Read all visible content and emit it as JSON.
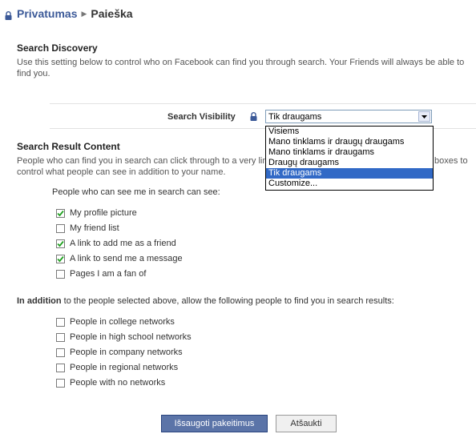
{
  "breadcrumb": {
    "parent": "Privatumas",
    "current": "Paieška"
  },
  "discovery": {
    "title": "Search Discovery",
    "description": "Use this setting below to control who on Facebook can find you through search. Your Friends will always be able to find you."
  },
  "visibility": {
    "label": "Search Visibility",
    "selected": "Tik draugams",
    "options": [
      "Visiems",
      "Mano tinklams ir draugų draugams",
      "Mano tinklams ir draugams",
      "Draugų draugams",
      "Tik draugams",
      "Customize..."
    ],
    "highlighted_index": 4
  },
  "result_content": {
    "title": "Search Result Content",
    "description_left": "People who can find you in search can click through to a very limi",
    "description_right": "boxes to",
    "description_line2": "control what people can see in addition to your name.",
    "subheading": "People who can see me in search can see:",
    "options": [
      {
        "label": "My profile picture",
        "checked": true
      },
      {
        "label": "My friend list",
        "checked": false
      },
      {
        "label": "A link to add me as a friend",
        "checked": true
      },
      {
        "label": "A link to send me a message",
        "checked": true
      },
      {
        "label": "Pages I am a fan of",
        "checked": false
      }
    ]
  },
  "addition": {
    "bold": "In addition",
    "text": " to the people selected above, allow the following people to find you in search results:",
    "options": [
      {
        "label": "People in college networks",
        "checked": false
      },
      {
        "label": "People in high school networks",
        "checked": false
      },
      {
        "label": "People in company networks",
        "checked": false
      },
      {
        "label": "People in regional networks",
        "checked": false
      },
      {
        "label": "People with no networks",
        "checked": false
      }
    ]
  },
  "buttons": {
    "save": "Išsaugoti pakeitimus",
    "cancel": "Atšaukti"
  },
  "colors": {
    "link": "#3b5998",
    "primary_button": "#5b74a8",
    "selection": "#3169c6"
  }
}
